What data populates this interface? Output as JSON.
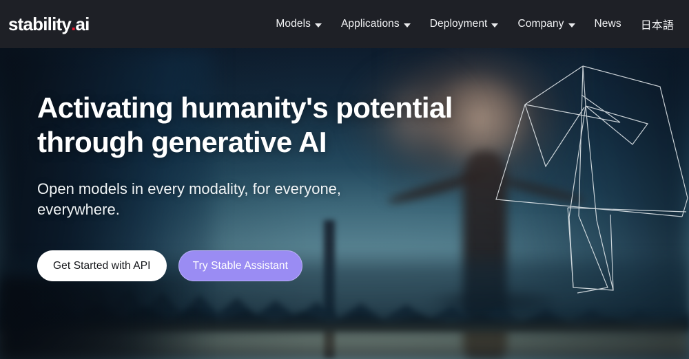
{
  "header": {
    "logo": {
      "name": "stability",
      "dot": ".",
      "suffix": "ai"
    },
    "nav": [
      {
        "label": "Models",
        "has_caret": true,
        "icon": "chevron-down-icon"
      },
      {
        "label": "Applications",
        "has_caret": true,
        "icon": "chevron-down-icon"
      },
      {
        "label": "Deployment",
        "has_caret": true,
        "icon": "chevron-down-icon"
      },
      {
        "label": "Company",
        "has_caret": true,
        "icon": "chevron-down-icon"
      },
      {
        "label": "News",
        "has_caret": false,
        "icon": ""
      },
      {
        "label": "日本語",
        "has_caret": false,
        "icon": ""
      }
    ]
  },
  "hero": {
    "headline": "Activating humanity's potential through generative AI",
    "subheadline": "Open models in every modality, for everyone, everywhere.",
    "cta": {
      "primary_label": "Get Started with API",
      "secondary_label": "Try Stable Assistant"
    },
    "background_art": "blurred-forest-tree-night-scene",
    "overlay_graphic": "geometric-wireframe-bird"
  },
  "colors": {
    "header_bg": "#1e2026",
    "logo_dot": "#e8132b",
    "accent_purple": "#9a8cf3",
    "primary_button_bg": "#ffffff",
    "primary_button_text": "#14161a",
    "text_on_hero": "#ffffff",
    "hero_sky": "#63929c"
  }
}
